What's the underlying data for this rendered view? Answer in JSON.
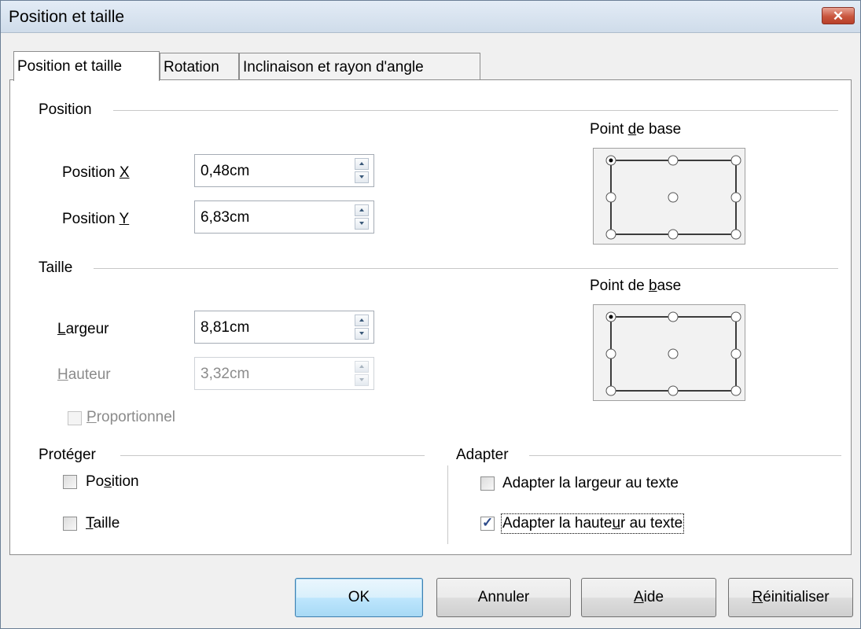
{
  "window": {
    "title": "Position et taille",
    "close_icon": "close-icon"
  },
  "tabs": [
    {
      "label": "Position et taille",
      "active": true
    },
    {
      "label": "Rotation",
      "active": false
    },
    {
      "label": "Inclinaison et rayon d'angle",
      "active": false
    }
  ],
  "position_group": {
    "title": "Position",
    "x": {
      "label_pre": "Position ",
      "label_mn": "X",
      "value": "0,48cm"
    },
    "y": {
      "label_pre": "Position ",
      "label_mn": "Y",
      "value": "6,83cm"
    },
    "base_point": {
      "label_pre": "Point ",
      "label_mn": "d",
      "label_post": "e base",
      "selected": "top-left"
    }
  },
  "size_group": {
    "title": "Taille",
    "width": {
      "label_mn": "L",
      "label_post": "argeur",
      "value": "8,81cm"
    },
    "height": {
      "label_mn": "H",
      "label_post": "auteur",
      "value": "3,32cm",
      "disabled": true
    },
    "proportional": {
      "label_mn": "P",
      "label_post": "roportionnel",
      "checked": false,
      "disabled": true
    },
    "base_point": {
      "label_pre": "Point de ",
      "label_mn": "b",
      "label_post": "ase",
      "selected": "top-left"
    }
  },
  "protect_group": {
    "title": "Protéger",
    "position": {
      "label_pre": "Po",
      "label_mn": "s",
      "label_post": "ition",
      "checked": false
    },
    "size": {
      "label_mn": "T",
      "label_post": "aille",
      "checked": false
    }
  },
  "fit_group": {
    "title": "Adapter",
    "fit_width": {
      "label_pre": "Adapter la lar",
      "label_mn": "g",
      "label_post": "eur au texte",
      "checked": false
    },
    "fit_height": {
      "label_pre": "Adapter la haute",
      "label_mn": "u",
      "label_post": "r au texte",
      "checked": true
    }
  },
  "buttons": {
    "ok": {
      "label": "OK"
    },
    "cancel": {
      "label": "Annuler"
    },
    "help": {
      "label_mn": "A",
      "label_post": "ide"
    },
    "reset": {
      "label_mn": "R",
      "label_post": "éinitialiser"
    }
  }
}
